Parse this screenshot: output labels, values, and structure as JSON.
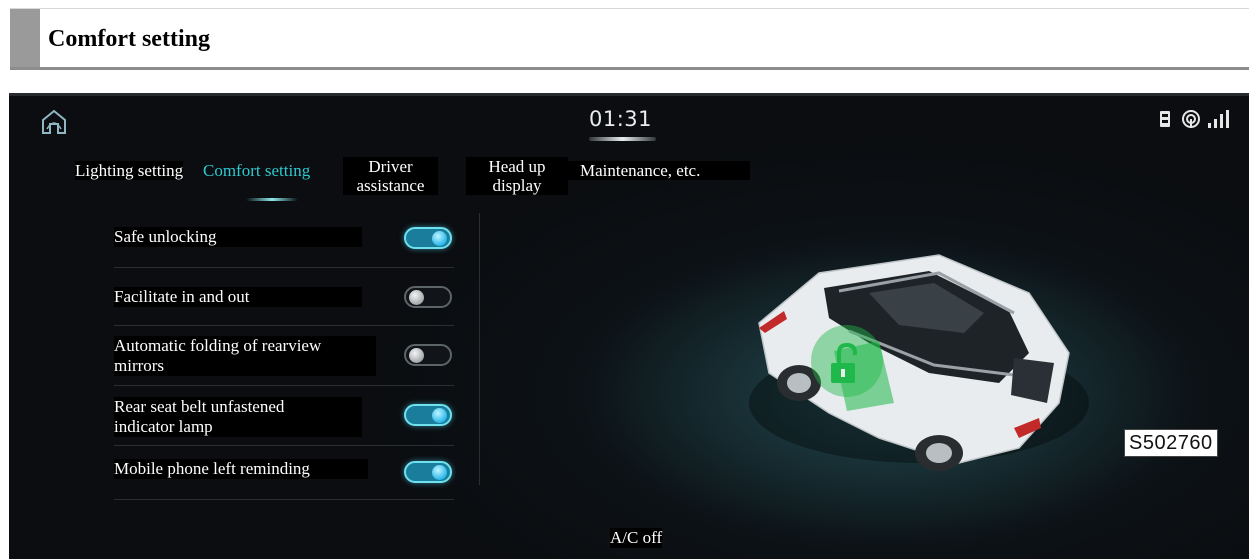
{
  "document": {
    "heading": "Comfort setting"
  },
  "status_bar": {
    "time": "01:31",
    "icons": [
      "home-icon",
      "usb-icon",
      "wireless-icon",
      "signal-icon"
    ]
  },
  "tabs": [
    {
      "label": "Lighting setting",
      "active": false
    },
    {
      "label": "Comfort setting",
      "active": true
    },
    {
      "label_line1": "Driver",
      "label_line2": "assistance",
      "active": false
    },
    {
      "label_line1": "Head up",
      "label_line2": "display",
      "active": false
    },
    {
      "label": "Maintenance, etc.",
      "active": false
    }
  ],
  "settings": [
    {
      "label": "Safe unlocking",
      "on": true
    },
    {
      "label": "Facilitate in and out",
      "on": false
    },
    {
      "label_line1": "Automatic folding of rearview",
      "label_line2": "mirrors",
      "on": false
    },
    {
      "label_line1": "Rear seat belt unfastened",
      "label_line2": "indicator lamp",
      "on": true
    },
    {
      "label": "Mobile phone left reminding",
      "on": true
    }
  ],
  "footer": {
    "ac_status": "A/C off",
    "figure_code": "S502760"
  },
  "colors": {
    "accent": "#2ec9cf",
    "toggle_on": "#1b7d9c",
    "unlock_green": "#1fb84a"
  }
}
